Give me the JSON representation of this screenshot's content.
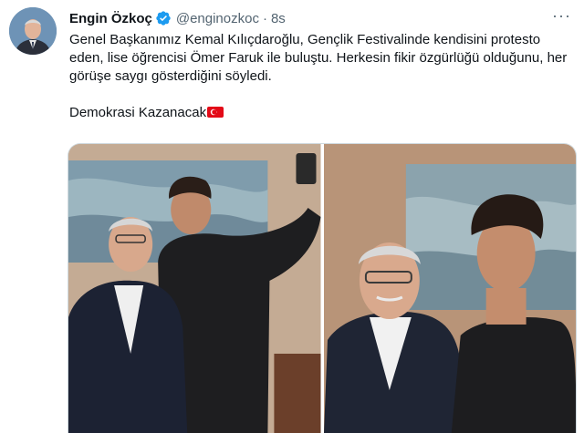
{
  "tweet": {
    "author_name": "Engin Özkoç",
    "handle": "@enginozkoc",
    "separator": "·",
    "time": "8s",
    "more_icon": "more-icon",
    "verified_icon": "verified-badge-icon",
    "text_paragraph_1": "Genel Başkanımız Kemal Kılıçdaroğlu, Gençlik Festivalinde kendisini protesto eden, lise öğrencisi Ömer Faruk ile buluştu. Herkesin fikir özgürlüğü olduğunu, her görüşe saygı gösterdiğini söyledi.",
    "text_paragraph_2": "Demokrasi Kazanacak",
    "flag_icon": "turkey-flag-icon"
  },
  "colors": {
    "verified": "#1d9bf0",
    "secondary_text": "#536471",
    "flag_red": "#e30a17"
  }
}
